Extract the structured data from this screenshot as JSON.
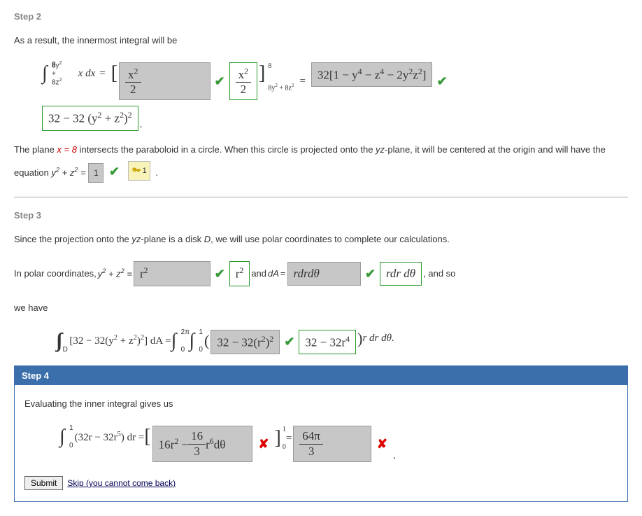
{
  "step2": {
    "head": "Step 2",
    "intro": "As a result, the innermost integral will be",
    "int_top": "8",
    "int_bot_html": "8y<sup>2</sup> + 8z<sup>2</sup>",
    "integrand": "x dx",
    "eq": "=",
    "ans1_grey_html": "x<sup>2</sup>",
    "ans1_grey_den": "2",
    "ans1_green_num_html": "x<sup>2</sup>",
    "ans1_green_den": "2",
    "limits_top": "8",
    "limits_bot_html": "8y<sup>2</sup> + 8z<sup>2</sup>",
    "ans2_grey_html": "32[1 − y<sup>4</sup> − z<sup>4</sup> − 2y<sup>2</sup>z<sup>2</sup>]",
    "ans2_green_html": "32 − 32 (y<sup>2</sup> + z<sup>2</sup>)<sup>2</sup>",
    "para_a": "The plane ",
    "para_x8": "x = 8",
    "para_b": " intersects the paraboloid in a circle. When this circle is projected onto the ",
    "para_yz": "yz",
    "para_c": "-plane, it will be centered at the origin and will have the equation ",
    "para_eq_html": "y<sup>2</sup> + z<sup>2</sup> = ",
    "small_in": "1",
    "key_val": "1",
    "period": "."
  },
  "step3": {
    "head": "Step 3",
    "intro_a": "Since the projection onto the ",
    "intro_yz": "yz",
    "intro_b": "-plane is a disk ",
    "intro_D": "D",
    "intro_c": ", we will use polar coordinates to complete our calculations.",
    "line2_a": "In polar coordinates, ",
    "line2_eq_html": "y<sup>2</sup> + z<sup>2</sup> = ",
    "ans_r2_grey_html": "r<sup>2</sup>",
    "ans_r2_green_html": "r<sup>2</sup>",
    "and_dA": " and ",
    "dA": "dA",
    "eq": " = ",
    "ans_rdr_grey": "rdrdθ",
    "ans_rdr_green": "rdr dθ",
    "and_so": ", and so",
    "we_have": "we have",
    "dbl_int_D": "D",
    "left_expr_html": "[32 − 32(y<sup>2</sup> + z<sup>2</sup>)<sup>2</sup>] dA = ",
    "int1_top": "2π",
    "int1_bot": "0",
    "int2_top": "1",
    "int2_bot": "0",
    "open_paren": "(",
    "ans_expr_grey_html": "32 − 32(r<sup>2</sup>)<sup>2</sup>",
    "ans_expr_green_html": "32 − 32r<sup>4</sup>",
    "close_paren": ")",
    "rdrdth": " r dr dθ."
  },
  "step4": {
    "head": "Step 4",
    "intro": "Evaluating the inner integral gives us",
    "int_top": "1",
    "int_bot": "0",
    "integrand_html": "(32r − 32r<sup>5</sup>) dr = ",
    "bracket_open": "[",
    "ans1_grey_html": "16r<sup>2</sup> − ",
    "ans1_grey_frac_num": "16",
    "ans1_grey_frac_den": "3",
    "ans1_grey_tail_html": "r<sup>6</sup>dθ",
    "bracket_close": "]",
    "lim_top": "1",
    "lim_bot": "0",
    "eq": " = ",
    "ans2_num": "64π",
    "ans2_den": "3",
    "period": ".",
    "submit": "Submit",
    "skip": "Skip (you cannot come back)"
  }
}
